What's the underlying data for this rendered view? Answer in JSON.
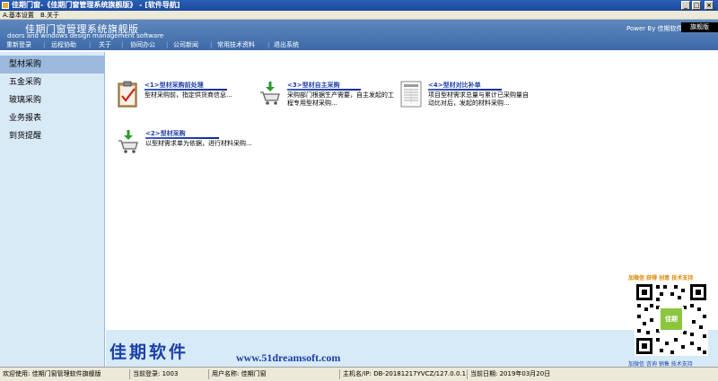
{
  "window": {
    "title": "佳期门窗-《佳期门窗管理系统旗舰版》 - [软件导航]",
    "buttons": {
      "minimize": "_",
      "maximize": "□",
      "close": "×"
    }
  },
  "menubar": {
    "items": [
      "A.基本设置",
      "B.关于"
    ]
  },
  "header": {
    "logo_cn": "佳期门窗管理系统旗舰版",
    "logo_en": "doors and windows design management software",
    "power_by": "Power By 佳期软件",
    "edition": "旗舰版",
    "nav": [
      "重新登录",
      "远程协助",
      "关于",
      "协同办公",
      "公司新闻",
      "常用技术资料",
      "退出系统"
    ]
  },
  "sidebar": {
    "items": [
      {
        "label": "型材采购",
        "active": true
      },
      {
        "label": "五金采购",
        "active": false
      },
      {
        "label": "玻璃采购",
        "active": false
      },
      {
        "label": "业务报表",
        "active": false
      },
      {
        "label": "到货提醒",
        "active": false
      }
    ]
  },
  "cards": [
    {
      "title": "<1>型材采购前处理",
      "desc": "型材采购前，指定供货商信息...",
      "icon": "clipboard-check-icon"
    },
    {
      "title": "<3>型材自主采购",
      "desc": "采购部门根据生产需要，自主发起的工程专用型材采购...",
      "icon": "shopping-cart-icon"
    },
    {
      "title": "<4>型材对比补单",
      "desc": "项目型材需求总量与累计已采购量自动比对后，发起的材料采购...",
      "icon": "document-report-icon"
    },
    {
      "title": "<2>型材采购",
      "desc": "以型材需求单为依据，进行材料采购...",
      "icon": "shopping-cart-icon"
    }
  ],
  "footer": {
    "brand_cn": "佳期软件",
    "brand_url": "www.51dreamsoft.com"
  },
  "qr": {
    "top_text": "加微信 获得 创意 技术支持",
    "center_text": "佳期",
    "bottom_text": "加微信 咨询 销售 技术支持"
  },
  "statusbar": {
    "welcome": "欢迎使用: 佳期门窗管理软件旗舰版",
    "login": "当前登录: 1003",
    "user": "用户名称: 佳期门窗",
    "host": "主机名/IP: DB-20181217YVCZ/127.0.0.1",
    "date": "当前日期: 2019年03月20日"
  },
  "colors": {
    "title_bar": "#1c4a9c",
    "banner": "#4a76b2",
    "sidebar_bg": "#d9eaf7",
    "sidebar_active": "#9cb9de",
    "card_title": "#1f3fa8",
    "brand": "#1c3fa8"
  }
}
